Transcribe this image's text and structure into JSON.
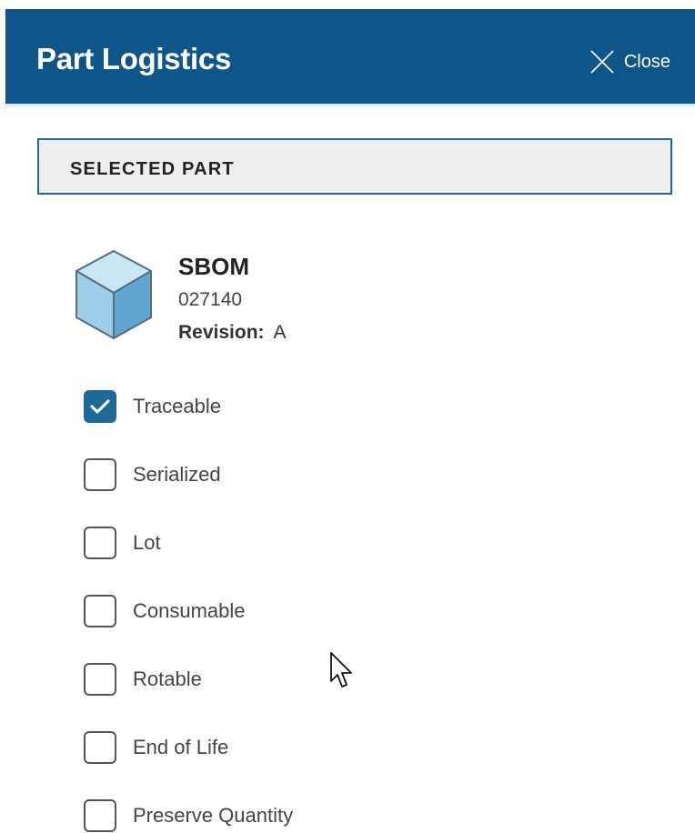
{
  "panel": {
    "title": "Part Logistics",
    "close_label": "Close"
  },
  "section": {
    "label": "SELECTED PART"
  },
  "part": {
    "icon": "cube-icon",
    "name": "SBOM",
    "number": "027140",
    "revision_label": "Revision:",
    "revision_value": "A"
  },
  "options": [
    {
      "label": "Traceable",
      "checked": true
    },
    {
      "label": "Serialized",
      "checked": false
    },
    {
      "label": "Lot",
      "checked": false
    },
    {
      "label": "Consumable",
      "checked": false
    },
    {
      "label": "Rotable",
      "checked": false
    },
    {
      "label": "End of Life",
      "checked": false
    },
    {
      "label": "Preserve Quantity",
      "checked": false
    }
  ],
  "colors": {
    "header": "#0e568a",
    "accent": "#1c6a95",
    "section_background": "#eeeeee"
  }
}
